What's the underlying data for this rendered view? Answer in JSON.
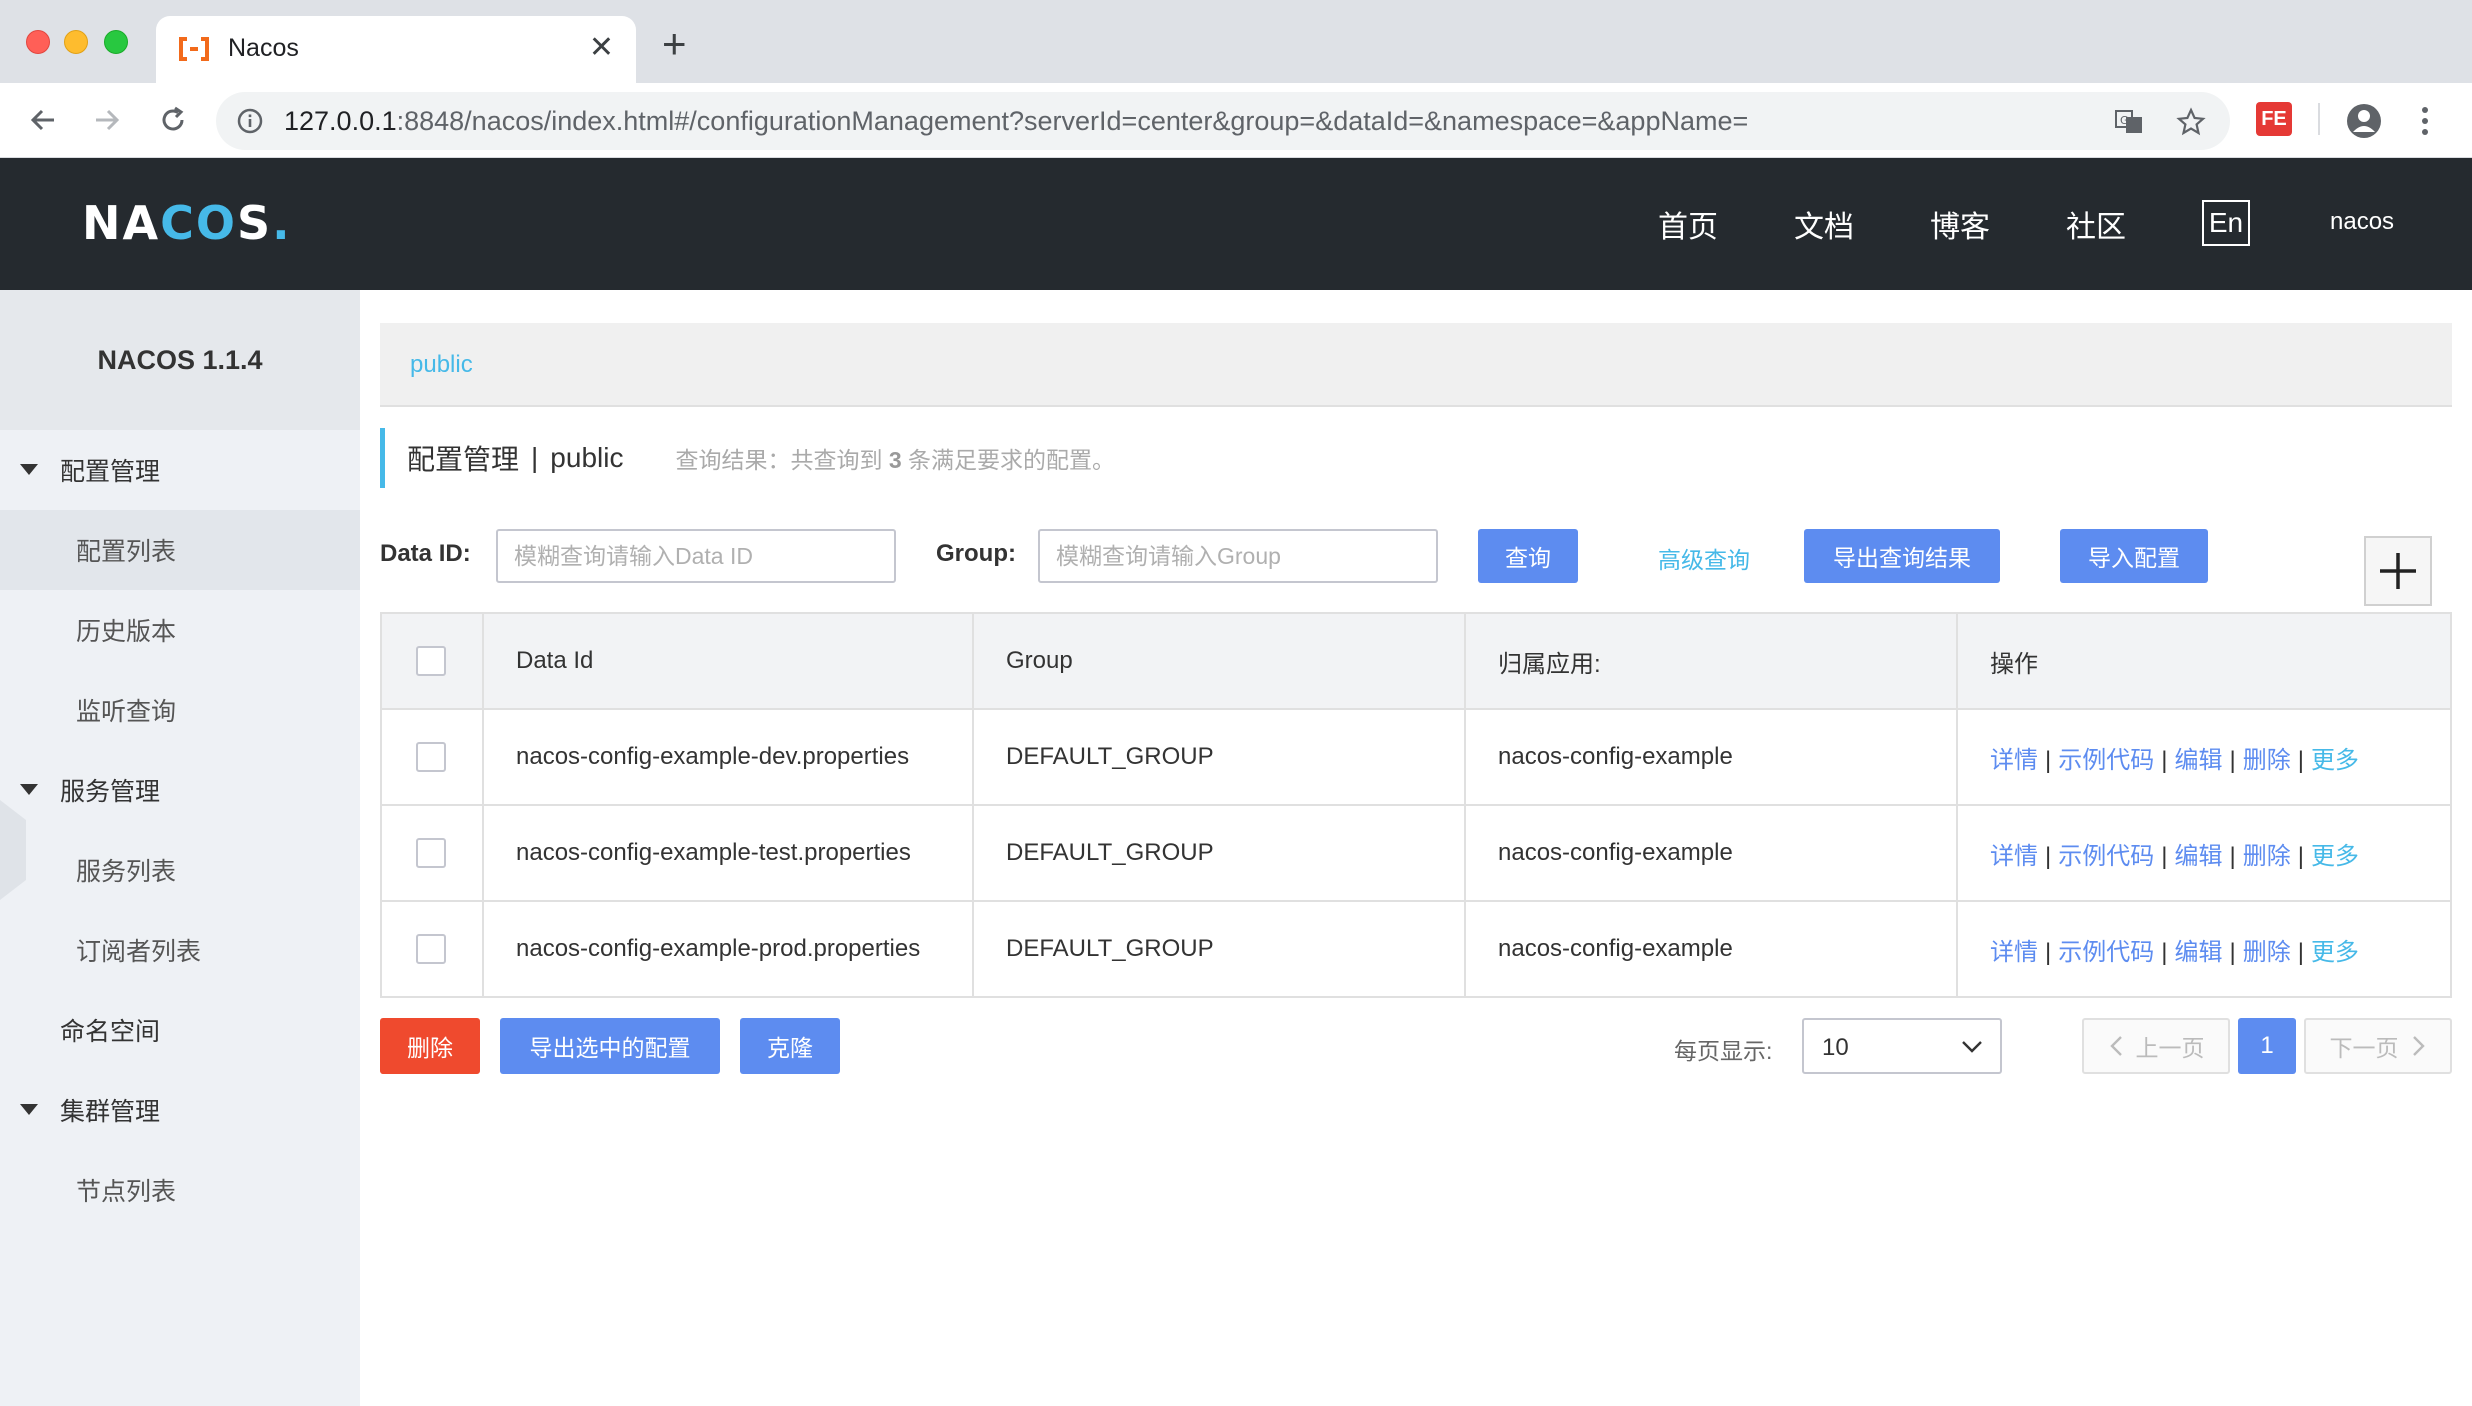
{
  "browser": {
    "tab_title": "Nacos",
    "url_host": "127.0.0.1",
    "url_rest": ":8848/nacos/index.html#/configurationManagement?serverId=center&group=&dataId=&namespace=&appName=",
    "ext_label": "FE"
  },
  "header": {
    "logo_a": "NA",
    "logo_c": "C",
    "logo_o": "O",
    "logo_s": "S",
    "logo_dot": ".",
    "nav": [
      "首页",
      "文档",
      "博客",
      "社区"
    ],
    "lang": "En",
    "user": "nacos"
  },
  "sidebar": {
    "title": "NACOS 1.1.4",
    "groups": [
      {
        "label": "配置管理",
        "items": [
          "配置列表",
          "历史版本",
          "监听查询"
        ]
      },
      {
        "label": "服务管理",
        "items": [
          "服务列表",
          "订阅者列表"
        ]
      },
      {
        "label": "命名空间"
      },
      {
        "label": "集群管理",
        "items": [
          "节点列表"
        ]
      }
    ]
  },
  "main": {
    "namespace": "public",
    "title": "配置管理",
    "title_sep": "|",
    "title_ns": "public",
    "result_prefix": "查询结果：共查询到",
    "result_count": "3",
    "result_suffix": "条满足要求的配置。",
    "filter": {
      "dataid_label": "Data ID:",
      "dataid_placeholder": "模糊查询请输入Data ID",
      "group_label": "Group:",
      "group_placeholder": "模糊查询请输入Group",
      "query_btn": "查询",
      "advanced": "高级查询",
      "export_btn": "导出查询结果",
      "import_btn": "导入配置"
    },
    "table": {
      "headers": [
        "Data Id",
        "Group",
        "归属应用:",
        "操作"
      ],
      "rows": [
        {
          "data_id": "nacos-config-example-dev.properties",
          "group": "DEFAULT_GROUP",
          "app": "nacos-config-example"
        },
        {
          "data_id": "nacos-config-example-test.properties",
          "group": "DEFAULT_GROUP",
          "app": "nacos-config-example"
        },
        {
          "data_id": "nacos-config-example-prod.properties",
          "group": "DEFAULT_GROUP",
          "app": "nacos-config-example"
        }
      ],
      "ops": {
        "detail": "详情",
        "sample": "示例代码",
        "edit": "编辑",
        "delete": "删除",
        "more": "更多",
        "sep": "|"
      }
    },
    "footer": {
      "delete_btn": "删除",
      "export_selected_btn": "导出选中的配置",
      "clone_btn": "克隆",
      "page_size_label": "每页显示:",
      "page_size": "10",
      "prev": "上一页",
      "current_page": "1",
      "next": "下一页"
    }
  },
  "colors": {
    "primary": "#5d8cf0",
    "danger": "#ef4a2e",
    "accent": "#46b9e8",
    "header_bg": "#252a2f"
  }
}
